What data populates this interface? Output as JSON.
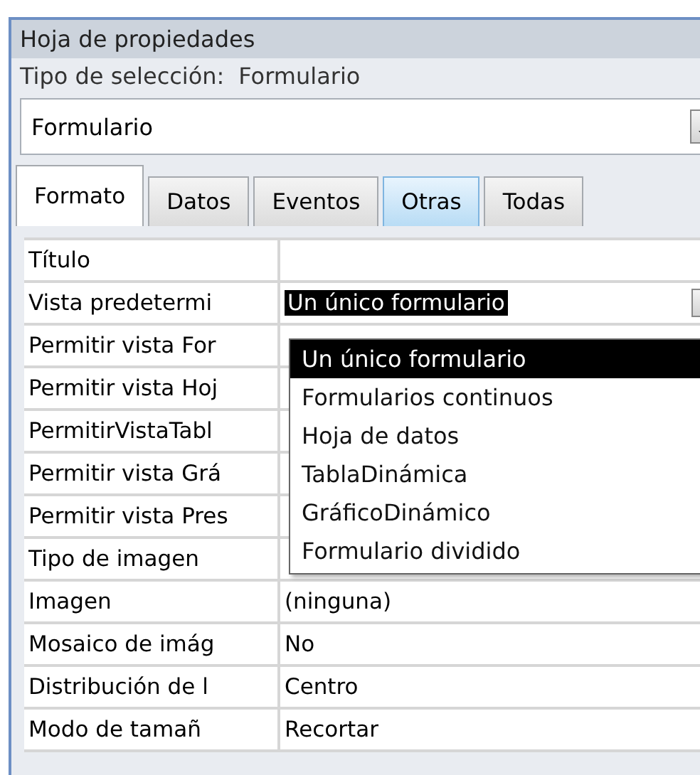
{
  "panel": {
    "title": "Hoja de propiedades",
    "selection_label": "Tipo de selección:",
    "selection_value": "Formulario"
  },
  "object_combo": {
    "value": "Formulario"
  },
  "tabs": [
    {
      "label": "Formato",
      "selected": true,
      "highlighted": false
    },
    {
      "label": "Datos",
      "selected": false,
      "highlighted": false
    },
    {
      "label": "Eventos",
      "selected": false,
      "highlighted": false
    },
    {
      "label": "Otras",
      "selected": false,
      "highlighted": true
    },
    {
      "label": "Todas",
      "selected": false,
      "highlighted": false
    }
  ],
  "properties": [
    {
      "label": "Título"
    },
    {
      "label": "Vista predetermi",
      "value": "Un único formulario",
      "kind": "combo"
    },
    {
      "label": "Permitir vista For"
    },
    {
      "label": "Permitir vista Hoj"
    },
    {
      "label": "PermitirVistaTabl"
    },
    {
      "label": "Permitir vista Grá"
    },
    {
      "label": "Permitir vista Pres"
    },
    {
      "label": "Tipo de imagen"
    },
    {
      "label": "Imagen",
      "value": "(ninguna)"
    },
    {
      "label": "Mosaico de imág",
      "value": "No"
    },
    {
      "label": "Distribución de l",
      "value": "Centro"
    },
    {
      "label": "Modo de tamañ",
      "value": "Recortar"
    }
  ],
  "dropdown": {
    "items": [
      {
        "label": "Un único formulario",
        "selected": true
      },
      {
        "label": "Formularios continuos",
        "selected": false
      },
      {
        "label": "Hoja de datos",
        "selected": false
      },
      {
        "label": "TablaDinámica",
        "selected": false
      },
      {
        "label": "GráficoDinámico",
        "selected": false
      },
      {
        "label": "Formulario dividido",
        "selected": false
      }
    ]
  }
}
